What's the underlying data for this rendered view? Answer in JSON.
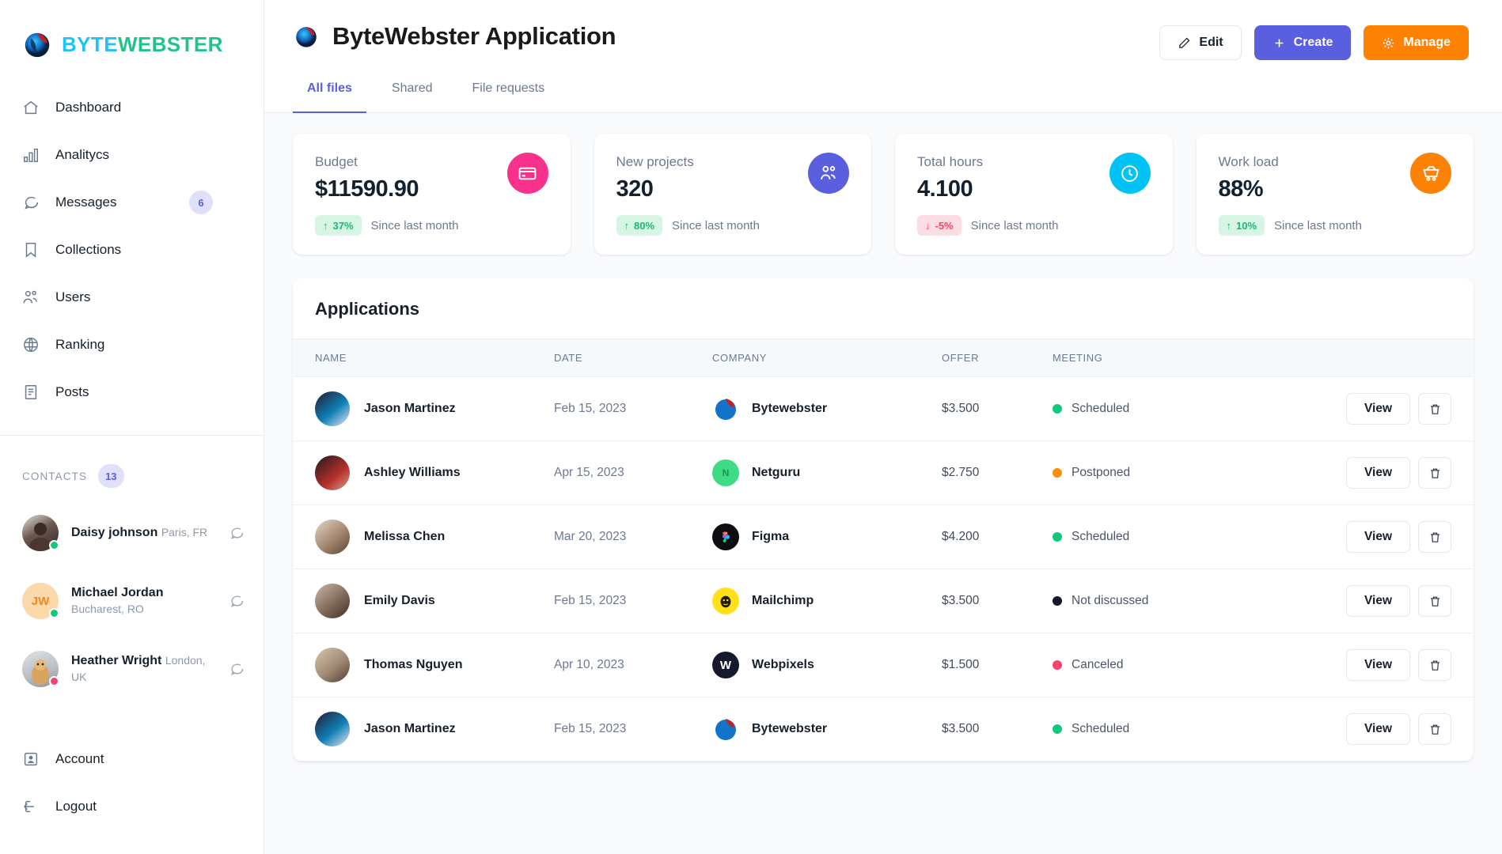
{
  "brand": {
    "part1": "BYTE",
    "part2": "WEBSTER",
    "logo_icon": "globe-logo-icon"
  },
  "sidebar": {
    "items": [
      {
        "label": "Dashboard",
        "icon": "home-icon",
        "badge": null
      },
      {
        "label": "Analitycs",
        "icon": "bar-chart-icon",
        "badge": null
      },
      {
        "label": "Messages",
        "icon": "chat-bubble-icon",
        "badge": "6"
      },
      {
        "label": "Collections",
        "icon": "bookmark-icon",
        "badge": null
      },
      {
        "label": "Users",
        "icon": "users-icon",
        "badge": null
      },
      {
        "label": "Ranking",
        "icon": "globe-icon",
        "badge": null
      },
      {
        "label": "Posts",
        "icon": "document-icon",
        "badge": null
      }
    ],
    "contacts_title": "CONTACTS",
    "contacts_count": "13",
    "contacts": [
      {
        "name": "Daisy johnson",
        "location": "Paris, FR",
        "status_color": "#12c87f",
        "avatar_type": "photo",
        "avatar_initials": "",
        "avatar_bg": "#cfd4dc"
      },
      {
        "name": "Michael Jordan",
        "location": "Bucharest, RO",
        "status_color": "#12c87f",
        "avatar_type": "initials",
        "avatar_initials": "JW",
        "avatar_bg": "#fcd9ab"
      },
      {
        "name": "Heather Wright",
        "location": "London, UK",
        "status_color": "#f4436c",
        "avatar_type": "photo",
        "avatar_initials": "",
        "avatar_bg": "#c9cfd8"
      }
    ],
    "bottom": [
      {
        "label": "Account",
        "icon": "account-icon"
      },
      {
        "label": "Logout",
        "icon": "logout-icon"
      }
    ]
  },
  "header": {
    "title": "ByteWebster Application",
    "logo_icon": "globe-logo-icon",
    "buttons": [
      {
        "label": "Edit",
        "icon": "pencil-icon",
        "style": "edit"
      },
      {
        "label": "Create",
        "icon": "plus-icon",
        "style": "create"
      },
      {
        "label": "Manage",
        "icon": "gear-icon",
        "style": "manage"
      }
    ],
    "tabs": [
      {
        "label": "All files",
        "active": true
      },
      {
        "label": "Shared",
        "active": false
      },
      {
        "label": "File requests",
        "active": false
      }
    ]
  },
  "stats": [
    {
      "label": "Budget",
      "value": "$11590.90",
      "delta": "37%",
      "delta_dir": "up",
      "since": "Since last month",
      "icon": "credit-card-icon",
      "icon_bg": "#f7318c"
    },
    {
      "label": "New projects",
      "value": "320",
      "delta": "80%",
      "delta_dir": "up",
      "since": "Since last month",
      "icon": "users-icon",
      "icon_bg": "#5a5fe0"
    },
    {
      "label": "Total hours",
      "value": "4.100",
      "delta": "-5%",
      "delta_dir": "down",
      "since": "Since last month",
      "icon": "clock-icon",
      "icon_bg": "#00c3f5"
    },
    {
      "label": "Work load",
      "value": "88%",
      "delta": "10%",
      "delta_dir": "up",
      "since": "Since last month",
      "icon": "cart-icon",
      "icon_bg": "#fd8204"
    }
  ],
  "table": {
    "title": "Applications",
    "columns": [
      "NAME",
      "DATE",
      "COMPANY",
      "OFFER",
      "MEETING"
    ],
    "view_label": "View",
    "delete_icon": "trash-icon",
    "rows": [
      {
        "name": "Jason Martinez",
        "date": "Feb 15, 2023",
        "company": "Bytewebster",
        "company_logo": "bytewebster-logo",
        "company_bg": "#ffffff",
        "company_initial": "",
        "offer": "$3.500",
        "meeting": "Scheduled",
        "meeting_color": "#12c87f",
        "avatar_bg": "#3a2a46"
      },
      {
        "name": "Ashley Williams",
        "date": "Apr 15, 2023",
        "company": "Netguru",
        "company_logo": "netguru-logo",
        "company_bg": "#3ddc84",
        "company_initial": "N",
        "offer": "$2.750",
        "meeting": "Postponed",
        "meeting_color": "#fd8f04",
        "avatar_bg": "#7a2f2f"
      },
      {
        "name": "Melissa Chen",
        "date": "Mar 20, 2023",
        "company": "Figma",
        "company_logo": "figma-logo",
        "company_bg": "#0d0d12",
        "company_initial": "",
        "offer": "$4.200",
        "meeting": "Scheduled",
        "meeting_color": "#12c87f",
        "avatar_bg": "#a08a72"
      },
      {
        "name": "Emily Davis",
        "date": "Feb 15, 2023",
        "company": "Mailchimp",
        "company_logo": "mailchimp-logo",
        "company_bg": "#ffe01b",
        "company_initial": "",
        "offer": "$3.500",
        "meeting": "Not discussed",
        "meeting_color": "#111827",
        "avatar_bg": "#8e7b6c"
      },
      {
        "name": "Thomas Nguyen",
        "date": "Apr 10, 2023",
        "company": "Webpixels",
        "company_logo": "webpixels-logo",
        "company_bg": "#15192b",
        "company_initial": "W",
        "offer": "$1.500",
        "meeting": "Canceled",
        "meeting_color": "#f4436c",
        "avatar_bg": "#b4a08c"
      },
      {
        "name": "Jason Martinez",
        "date": "Feb 15, 2023",
        "company": "Bytewebster",
        "company_logo": "bytewebster-logo",
        "company_bg": "#ffffff",
        "company_initial": "",
        "offer": "$3.500",
        "meeting": "Scheduled",
        "meeting_color": "#12c87f",
        "avatar_bg": "#3a2a46"
      }
    ]
  }
}
